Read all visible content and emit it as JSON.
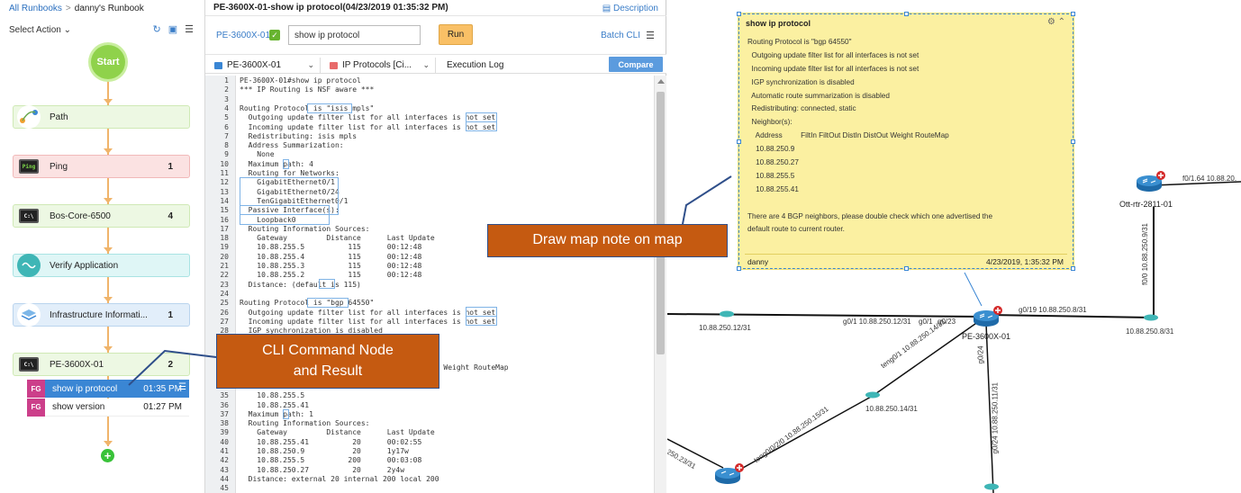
{
  "runbook": {
    "breadcrumb_root": "All Runbooks",
    "breadcrumb_separator": ">",
    "breadcrumb_current": "danny's Runbook",
    "select_action": "Select Action",
    "start_label": "Start",
    "end_symbol": "+",
    "nodes": [
      {
        "label": "Path",
        "count": "",
        "icon": "path-icon",
        "color": "green"
      },
      {
        "label": "Ping",
        "count": "1",
        "icon": "ping-monitor-icon",
        "color": "red"
      },
      {
        "label": "Bos-Core-6500",
        "count": "4",
        "icon": "cli-monitor-icon",
        "color": "green"
      },
      {
        "label": "Verify Application",
        "count": "",
        "icon": "application-wave-icon",
        "color": "cyan"
      },
      {
        "label": "Infrastructure Informati...",
        "count": "1",
        "icon": "layers-icon",
        "color": "blue"
      },
      {
        "label": "PE-3600X-01",
        "count": "2",
        "icon": "cli-monitor-icon",
        "color": "green"
      }
    ],
    "commands": [
      {
        "tag": "FG",
        "label": "show ip protocol",
        "time": "01:35 PM",
        "active": true
      },
      {
        "tag": "FG",
        "label": "show version",
        "time": "01:27 PM",
        "active": false
      }
    ]
  },
  "cli": {
    "title": "PE-3600X-01-show ip protocol(04/23/2019 01:35:32 PM)",
    "description_link": "Description",
    "device": "PE-3600X-01",
    "command_value": "show ip protocol",
    "run_label": "Run",
    "batch_cli": "Batch CLI",
    "device_dropdown": "PE-3600X-01",
    "protocol_dropdown": "IP Protocols [Ci...",
    "execution_log": "Execution Log",
    "compare_label": "Compare",
    "lines": [
      {
        "n": "1",
        "t": "PE-3600X-01#show ip protocol"
      },
      {
        "n": "2",
        "t": "*** IP Routing is NSF aware ***"
      },
      {
        "n": "3",
        "t": ""
      },
      {
        "n": "4",
        "t": "Routing Protocol is \"isis mpls\""
      },
      {
        "n": "5",
        "t": "  Outgoing update filter list for all interfaces is not set"
      },
      {
        "n": "6",
        "t": "  Incoming update filter list for all interfaces is not set"
      },
      {
        "n": "7",
        "t": "  Redistributing: isis mpls"
      },
      {
        "n": "8",
        "t": "  Address Summarization:"
      },
      {
        "n": "9",
        "t": "    None"
      },
      {
        "n": "10",
        "t": "  Maximum path: 4"
      },
      {
        "n": "11",
        "t": "  Routing for Networks:"
      },
      {
        "n": "12",
        "t": "    GigabitEthernet0/1"
      },
      {
        "n": "13",
        "t": "    GigabitEthernet0/24"
      },
      {
        "n": "14",
        "t": "    TenGigabitEthernet0/1"
      },
      {
        "n": "15",
        "t": "  Passive Interface(s):"
      },
      {
        "n": "16",
        "t": "    Loopback0"
      },
      {
        "n": "17",
        "t": "  Routing Information Sources:"
      },
      {
        "n": "18",
        "t": "    Gateway         Distance      Last Update"
      },
      {
        "n": "19",
        "t": "    10.88.255.5          115      00:12:48"
      },
      {
        "n": "20",
        "t": "    10.88.255.4          115      00:12:48"
      },
      {
        "n": "21",
        "t": "    10.88.255.3          115      00:12:48"
      },
      {
        "n": "22",
        "t": "    10.88.255.2          115      00:12:48"
      },
      {
        "n": "23",
        "t": "  Distance: (default is 115)"
      },
      {
        "n": "24",
        "t": ""
      },
      {
        "n": "25",
        "t": "Routing Protocol is \"bgp 64550\""
      },
      {
        "n": "26",
        "t": "  Outgoing update filter list for all interfaces is not set"
      },
      {
        "n": "27",
        "t": "  Incoming update filter list for all interfaces is not set"
      },
      {
        "n": "28",
        "t": "  IGP synchronization is disabled"
      },
      {
        "n": "",
        "t": ""
      },
      {
        "n": "",
        "t": ""
      },
      {
        "n": "",
        "t": ""
      },
      {
        "n": "",
        "t": "                                          tOut Weight RouteMap"
      },
      {
        "n": "",
        "t": ""
      },
      {
        "n": "",
        "t": ""
      },
      {
        "n": "35",
        "t": "    10.88.255.5"
      },
      {
        "n": "36",
        "t": "    10.88.255.41"
      },
      {
        "n": "37",
        "t": "  Maximum path: 1"
      },
      {
        "n": "38",
        "t": "  Routing Information Sources:"
      },
      {
        "n": "39",
        "t": "    Gateway         Distance      Last Update"
      },
      {
        "n": "40",
        "t": "    10.88.255.41          20      00:02:55"
      },
      {
        "n": "41",
        "t": "    10.88.250.9           20      1y17w"
      },
      {
        "n": "42",
        "t": "    10.88.255.5          200      00:03:08"
      },
      {
        "n": "43",
        "t": "    10.88.250.27          20      2y4w"
      },
      {
        "n": "44",
        "t": "  Distance: external 20 internal 200 local 200"
      },
      {
        "n": "45",
        "t": ""
      }
    ]
  },
  "note": {
    "title": "show ip protocol",
    "lines": [
      "Routing Protocol is \"bgp 64550\"",
      "  Outgoing update filter list for all interfaces is not set",
      "  Incoming update filter list for all interfaces is not set",
      "  IGP synchronization is disabled",
      "  Automatic route summarization is disabled",
      "  Redistributing: connected, static",
      "  Neighbor(s):",
      "    Address         FiltIn FiltOut DistIn DistOut Weight RouteMap",
      "    10.88.250.9",
      "    10.88.250.27",
      "    10.88.255.5",
      "    10.88.255.41",
      "",
      "There are 4 BGP neighbors, please double check which one advertised the",
      "default route to current router."
    ],
    "author": "danny",
    "timestamp": "4/23/2019, 1:35:32 PM"
  },
  "map": {
    "devices": [
      {
        "name": "PE-3600X-01",
        "icon": "router-icon",
        "alert": true
      },
      {
        "name": "Ott-rtr-2811-01",
        "icon": "router-icon",
        "alert": true
      }
    ],
    "labels": {
      "link_left_subnet": "10.88.250.12/31",
      "pe_g01": "g0/1 10.88.250.12/31",
      "pe_g01b": "g0/1",
      "pe_g023": "g0/23",
      "pe_g019": "g0/19 10.88.250.8/31",
      "right_subnet": "10.88.250.8/31",
      "ott_f01_64": "f0/1.64 10.88.20.",
      "ott_f00": "f0/0 10.88.250.9/31",
      "teng01": "teng0/1 10.88.250.14/31",
      "mid_subnet": "10.88.250.14/31",
      "teng002": "teng0/0/2/0 10.88.250.15/31",
      "g024": "g0/24",
      "g024_ip": "g0/24 10.88.250.11/31",
      "bottom_left": "250.23/31"
    }
  },
  "callouts": {
    "map_note": "Draw map note on map",
    "cli_node_line1": "CLI Command Node",
    "cli_node_line2": "and Result"
  }
}
